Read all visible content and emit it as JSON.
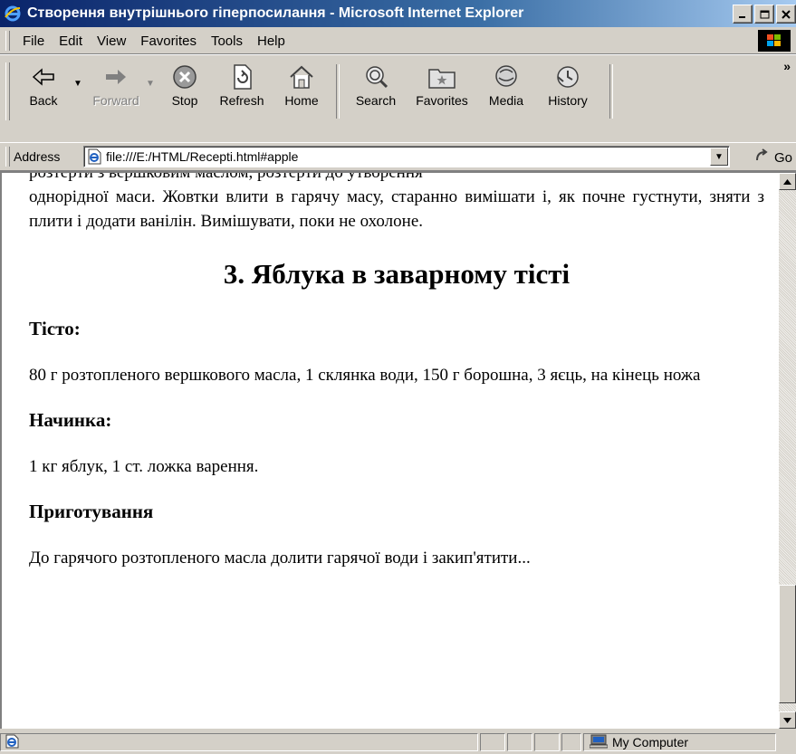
{
  "window": {
    "title": "Створення внутрішнього гіперпосилання - Microsoft Internet Explorer",
    "minimize": "_",
    "maximize": "□",
    "close": "×"
  },
  "menu": {
    "items": [
      {
        "label": "File"
      },
      {
        "label": "Edit"
      },
      {
        "label": "View"
      },
      {
        "label": "Favorites"
      },
      {
        "label": "Tools"
      },
      {
        "label": "Help"
      }
    ]
  },
  "toolbar": {
    "back": "Back",
    "forward": "Forward",
    "stop": "Stop",
    "refresh": "Refresh",
    "home": "Home",
    "search": "Search",
    "favorites": "Favorites",
    "media": "Media",
    "history": "History",
    "more": "»"
  },
  "address": {
    "label": "Address",
    "url": "file:///E:/HTML/Recepti.html#apple",
    "go": "Go"
  },
  "page": {
    "cut_line": "розтерти з вершковим маслом, розтерти до утворення",
    "intro_paragraph": "однорідної маси. Жовтки влити в гарячу масу, старанно вимішати і, як почне густнути, зняти з плити і додати ванілін. Вимішувати, поки не охолоне.",
    "heading": "3. Яблука в заварному тісті",
    "dough_title": "Тісто:",
    "dough_text": "80 г розтопленого вершкового масла, 1 склянка води, 150 г борошна, 3 яєць, на кінець ножа",
    "filling_title": "Начинка:",
    "filling_text": "1 кг яблук, 1 ст. ложка варення.",
    "prep_title": "Приготування",
    "prep_text": "До гарячого розтопленого масла долити гарячої води і закип'ятити..."
  },
  "status": {
    "zone": "My Computer"
  },
  "colors": {
    "titlebar_start": "#0a246a",
    "titlebar_end": "#a6caf0",
    "chrome": "#d4d0c8"
  }
}
